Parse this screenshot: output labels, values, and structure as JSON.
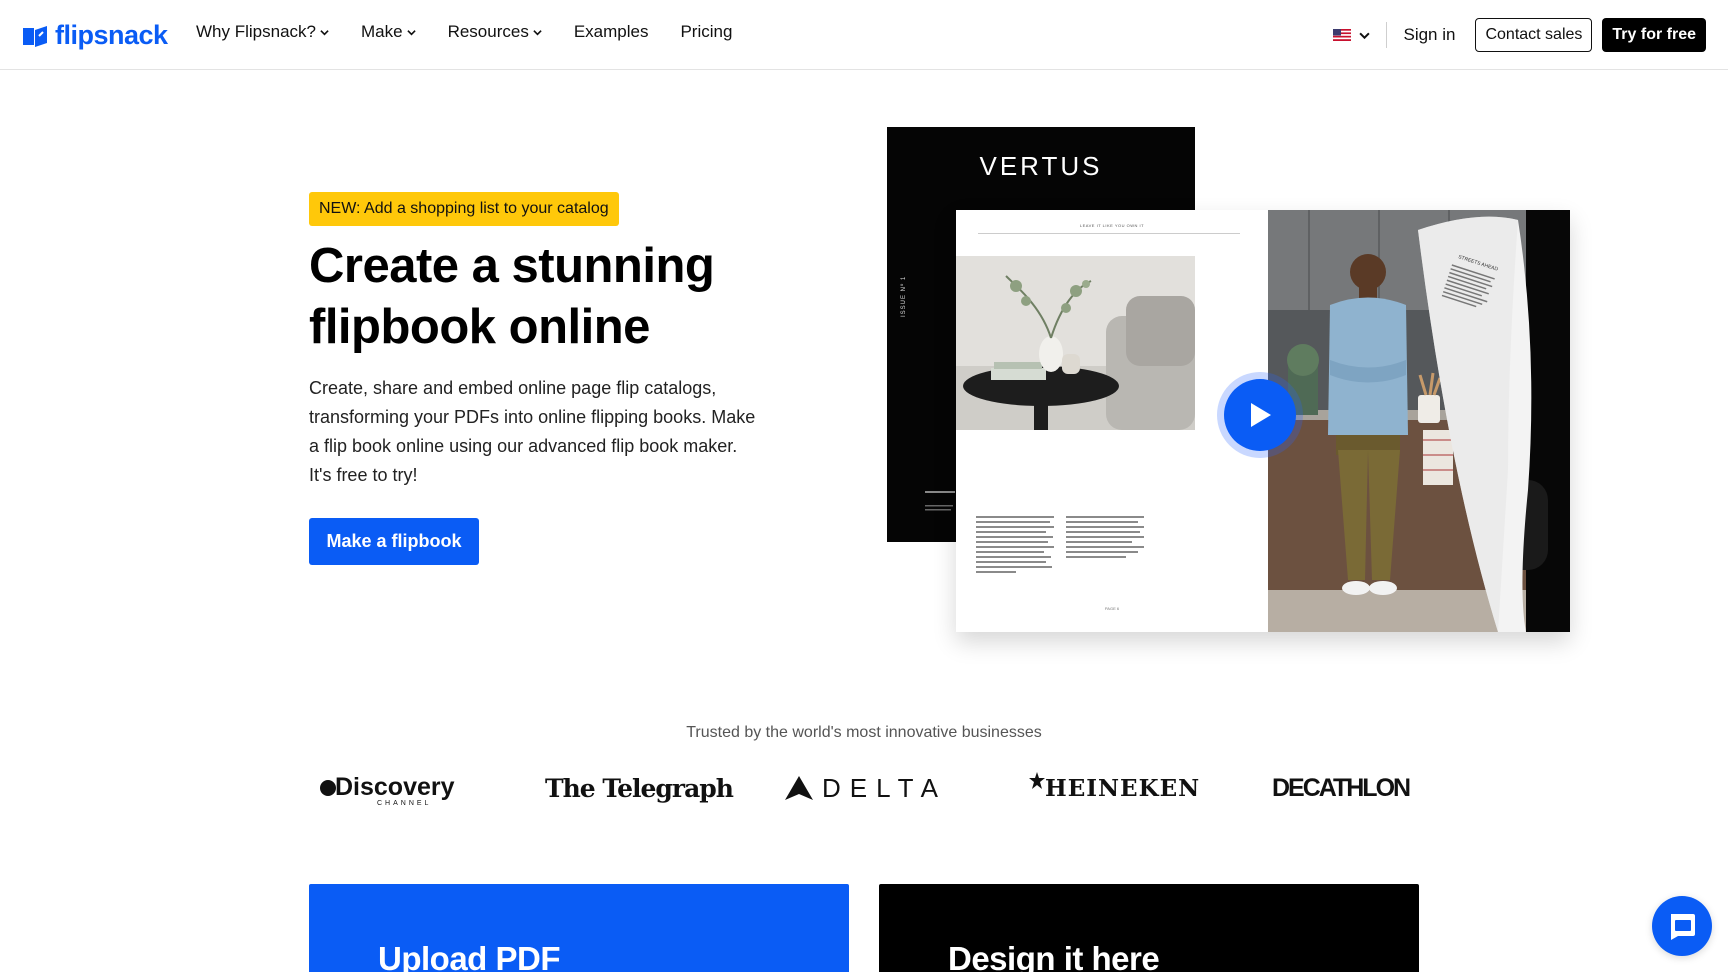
{
  "header": {
    "logo_text": "flipsnack",
    "nav": [
      {
        "label": "Why Flipsnack?",
        "dropdown": true
      },
      {
        "label": "Make",
        "dropdown": true
      },
      {
        "label": "Resources",
        "dropdown": true
      },
      {
        "label": "Examples",
        "dropdown": false
      },
      {
        "label": "Pricing",
        "dropdown": false
      }
    ],
    "language_icon": "us-flag-icon",
    "signin_label": "Sign in",
    "contact_label": "Contact sales",
    "try_label": "Try for free"
  },
  "hero": {
    "badge": "NEW: Add a shopping list to your catalog",
    "title": "Create a stunning flipbook online",
    "description": "Create, share and embed online page flip catalogs, transforming your PDFs into online flipping books. Make a flip book online using our advanced flip book maker. It's free to try!",
    "cta_label": "Make a flipbook",
    "magazine": {
      "brand": "VERTUS",
      "issue": "ISSUE Nº 1",
      "page_header": "LEAVE IT LIKE YOU OWN IT",
      "page_footer": "PAGE 6",
      "curl_title": "STREETS AHEAD"
    },
    "play_icon": "play-icon"
  },
  "trusted": {
    "heading": "Trusted by the world's most innovative businesses",
    "logos": [
      "Discovery",
      "The Telegraph",
      "DELTA",
      "HEINEKEN",
      "DECATHLON"
    ],
    "discovery_sub": "CHANNEL"
  },
  "cards": {
    "upload_title": "Upload PDF",
    "design_title": "Design it here"
  },
  "colors": {
    "brand_blue": "#0a5cf5",
    "badge_yellow": "#ffc80a",
    "black": "#000000"
  },
  "chat_icon": "chat-icon"
}
